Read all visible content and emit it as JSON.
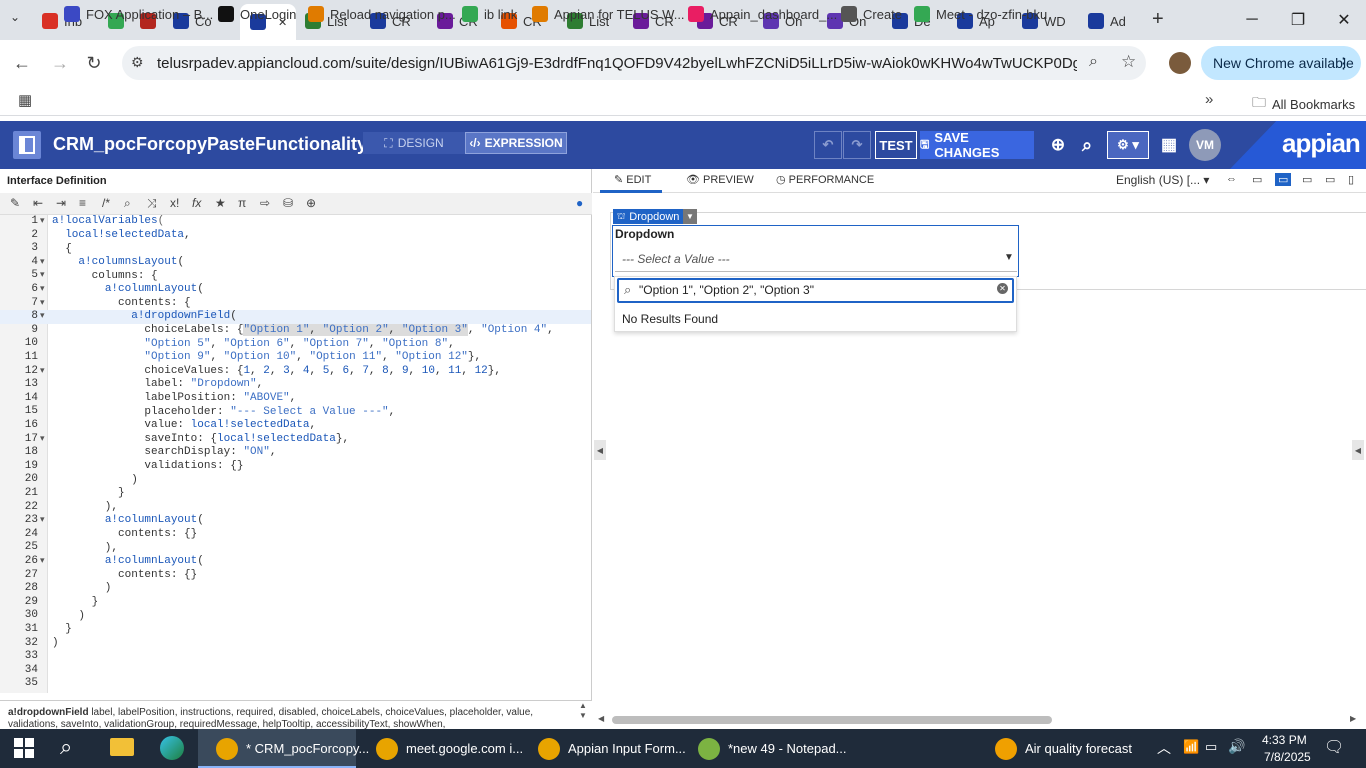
{
  "browser": {
    "tabs": [
      {
        "label": "Inb",
        "icon": "gmail-icon",
        "color": "#d93025"
      },
      {
        "label": "",
        "icon": "app-icon",
        "color": "#34a853"
      },
      {
        "label": "",
        "icon": "record-icon",
        "color": "#b3261e"
      },
      {
        "label": "Co",
        "icon": "appian-icon",
        "color": "#1a3a9c"
      },
      {
        "label": "",
        "icon": "appian-designer-icon",
        "color": "#1a3a9c",
        "active": true
      },
      {
        "label": "List",
        "icon": "list-icon",
        "color": "#2e7d32"
      },
      {
        "label": "CR",
        "icon": "link-icon",
        "color": "#1a3a9c"
      },
      {
        "label": "CR",
        "icon": "expression-icon",
        "color": "#6a1b9a"
      },
      {
        "label": "CR",
        "icon": "table-icon",
        "color": "#e65100"
      },
      {
        "label": "List",
        "icon": "list-icon",
        "color": "#2e7d32"
      },
      {
        "label": "CR",
        "icon": "expression-icon",
        "color": "#6a1b9a"
      },
      {
        "label": "CR",
        "icon": "expression-icon",
        "color": "#6a1b9a"
      },
      {
        "label": "On",
        "icon": "p-icon",
        "color": "#5e35b1"
      },
      {
        "label": "On",
        "icon": "p-icon",
        "color": "#5e35b1"
      },
      {
        "label": "De",
        "icon": "doc-icon",
        "color": "#1a3a9c"
      },
      {
        "label": "Ap",
        "icon": "appian-a-icon",
        "color": "#1a3a9c"
      },
      {
        "label": "WD",
        "icon": "doc-icon",
        "color": "#1a3a9c"
      },
      {
        "label": "Ad",
        "icon": "appian-a-icon",
        "color": "#1a3a9c"
      }
    ],
    "url": "telusrpadev.appiancloud.com/suite/design/IUBiwA61Gj9-E3drdfFnq1QOFD9V42byelLwhFZCNiD5iLLrD5iw-wAiok0wKHWo4wTwUCKP0Dg2Fh3TBBvr...",
    "new_chrome": "New Chrome available",
    "bookmarks": [
      {
        "label": "FOX Application – B...",
        "color": "#3b49c4"
      },
      {
        "label": "OneLogin",
        "color": "#111111"
      },
      {
        "label": "Reload navigation p...",
        "color": "#e07b00"
      },
      {
        "label": "ib link",
        "color": "#34a853"
      },
      {
        "label": "Appian for TELUS W...",
        "color": "#e07b00"
      },
      {
        "label": "Appain_dashboard_...",
        "color": "#e91e63"
      },
      {
        "label": "Create",
        "color": "#555555"
      },
      {
        "label": "Meet - dzo-zfin-bku",
        "color": "#34a853"
      }
    ],
    "all_bookmarks": "All Bookmarks"
  },
  "appian": {
    "title": "CRM_pocForcopyPasteFunctionality",
    "design": "DESIGN",
    "expression": "EXPRESSION",
    "test": "TEST",
    "save": "SAVE CHANGES",
    "avatar": "VM",
    "logo": "appian",
    "accent": "#2d4aa0"
  },
  "editor": {
    "title": "Interface Definition",
    "lines": [
      "1",
      "2",
      "3",
      "4",
      "5",
      "6",
      "7",
      "8",
      "9",
      "10",
      "11",
      "12",
      "13",
      "14",
      "15",
      "16",
      "17",
      "18",
      "19",
      "20",
      "21",
      "22",
      "23",
      "24",
      "25",
      "26",
      "27",
      "28",
      "29",
      "30",
      "31",
      "32",
      "33",
      "34",
      "35"
    ],
    "doc_fn": "a!dropdownField",
    "doc_params": " label, labelPosition, instructions, required, disabled, choiceLabels, choiceValues, placeholder, value, validations, saveInto, validationGroup, requiredMessage, helpTooltip, accessibilityText, showWhen,"
  },
  "preview": {
    "tab_edit": "EDIT",
    "tab_preview": "PREVIEW",
    "tab_performance": "PERFORMANCE",
    "locale": "English (US) [...",
    "component_tag": "Dropdown",
    "label": "Dropdown",
    "placeholder": "--- Select a Value ---",
    "search_text": "\"Option 1\", \"Option 2\",  \"Option 3\"",
    "no_results": "No Results Found"
  },
  "taskbar": {
    "apps": [
      {
        "label": "* CRM_pocForcopy...",
        "color": "#e8a400"
      },
      {
        "label": "meet.google.com i...",
        "color": "#e8a400"
      },
      {
        "label": "Appian Input Form...",
        "color": "#e8a400"
      },
      {
        "label": "*new 49 - Notepad...",
        "color": "#7cb342"
      },
      {
        "label": "Air quality forecast",
        "color": "#f0a000"
      }
    ],
    "time": "4:33 PM",
    "date": "7/8/2025"
  }
}
